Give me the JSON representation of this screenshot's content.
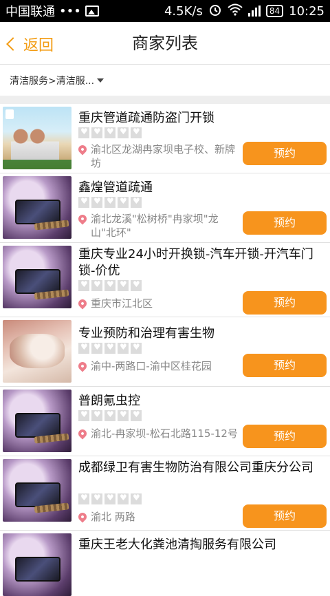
{
  "status": {
    "carrier": "中国联通",
    "dots": "•••",
    "speed": "4.5K/s",
    "battery": "84",
    "time": "10:25"
  },
  "nav": {
    "back_label": "返回",
    "title": "商家列表"
  },
  "filter": {
    "label": "清洁服务>清洁服..."
  },
  "merchants": [
    {
      "name": "重庆管道疏通防盗门开锁",
      "address": "渝北区龙湖冉家坝电子校、新牌坊",
      "button": "预约"
    },
    {
      "name": "鑫煌管道疏通",
      "address": "渝北龙溪\"松树桥\"冉家坝\"龙山\"北环\"",
      "button": "预约"
    },
    {
      "name": "重庆专业24小时开换锁-汽车开锁-开汽车门锁-价优",
      "address": "重庆市江北区",
      "button": "预约"
    },
    {
      "name": "专业预防和治理有害生物",
      "address": "渝中-两路口-渝中区桂花园",
      "button": "预约"
    },
    {
      "name": "普朗氪虫控",
      "address": "渝北-冉家坝-松石北路115-12号",
      "button": "预约"
    },
    {
      "name": "成都绿卫有害生物防治有限公司重庆分公司",
      "address": "渝北 两路",
      "button": "预约"
    },
    {
      "name": "重庆王老大化粪池清掏服务有限公司",
      "address": "",
      "button": ""
    }
  ]
}
